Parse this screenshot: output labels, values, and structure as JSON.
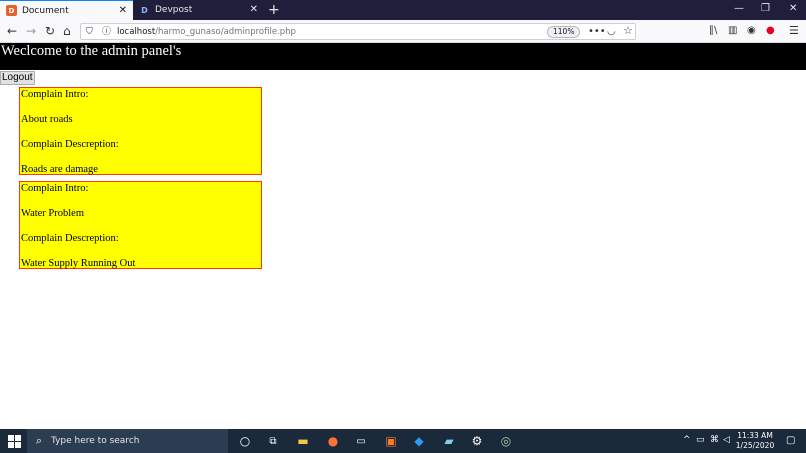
{
  "browser": {
    "tabs": [
      {
        "label": "Document",
        "favicon": "D",
        "active": true
      },
      {
        "label": "Devpost",
        "favicon": "D",
        "active": false
      }
    ],
    "url_host": "localhost",
    "url_path": "/harmo_gunaso/adminprofile.php",
    "zoom": "110%"
  },
  "page": {
    "header_title": "Weclcome to the admin panel's",
    "logout_label": "Logout",
    "complaints": [
      {
        "intro_label": "Complain Intro:",
        "intro": "About roads",
        "desc_label": "Complain Descreption:",
        "desc": "Roads are damage"
      },
      {
        "intro_label": "Complain Intro:",
        "intro": "Water Problem",
        "desc_label": "Complain Descreption:",
        "desc": "Water Supply Running Out"
      }
    ]
  },
  "taskbar": {
    "search_placeholder": "Type here to search",
    "time": "11:33 AM",
    "date": "1/25/2020"
  },
  "colors": {
    "card_bg": "#ffff00",
    "card_border": "#ff3b00",
    "header_bg": "#000000",
    "tab_strip": "#1f1f3b",
    "taskbar": "#1b2a3a"
  }
}
